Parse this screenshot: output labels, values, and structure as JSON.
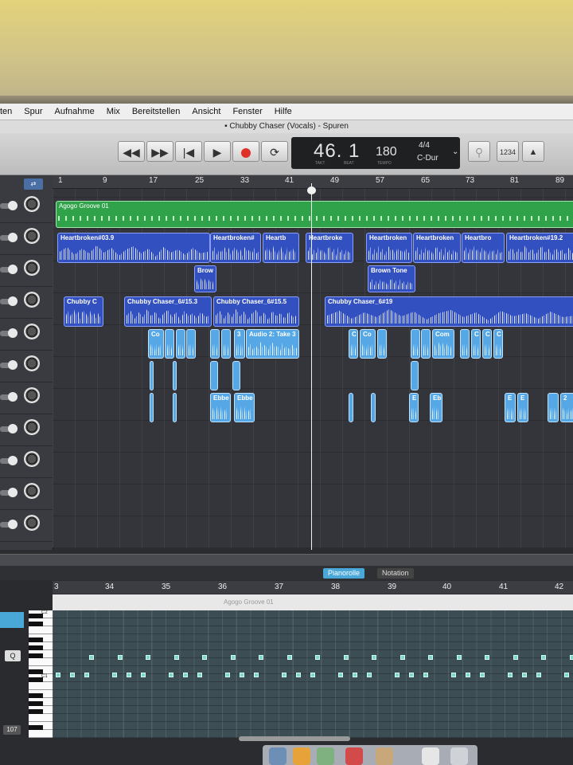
{
  "menu": {
    "items": [
      "ten",
      "Spur",
      "Aufnahme",
      "Mix",
      "Bereitstellen",
      "Ansicht",
      "Fenster",
      "Hilfe"
    ]
  },
  "window": {
    "title": "Chubby Chaser (Vocals) - Spuren"
  },
  "transport": {
    "rewind": "◀◀",
    "forward": "▶▶",
    "tostart": "|◀",
    "play": "▶",
    "cycle": "⟳",
    "tuner": "⚲",
    "count_in": "1234",
    "metronome": "▲"
  },
  "lcd": {
    "position": "46. 1",
    "tempo": "180",
    "signature": "4/4",
    "key": "C-Dur",
    "takt": "TAKT",
    "beat": "BEAT",
    "tempo_label": "TEMPO"
  },
  "ruler": {
    "bars": [
      "1",
      "9",
      "17",
      "25",
      "33",
      "41",
      "49",
      "57",
      "65",
      "73",
      "81",
      "89"
    ]
  },
  "regions": {
    "agogo": "Agogo Groove 01",
    "hb1": "Heartbroken#03.9",
    "hb2": "Heartbroken#",
    "hb3": "Heartb",
    "hb4": "Heartbroke",
    "hb5": "Heartbroken",
    "hb6": "Heartbroken",
    "hb7": "Heartbro",
    "hb8": "Heartbroken#19.2",
    "brow": "Brow",
    "brown": "Brown Tone",
    "cc1": "Chubby C",
    "cc2": "Chubby Chaser_6#15.3",
    "cc3": "Chubby Chaser_6#15.5",
    "cc4": "Chubby Chaser_6#19",
    "co1": "Co",
    "a3": "3",
    "audio2": "Audio 2: Take 3",
    "c1": "C",
    "co2": "Co",
    "com": "Com",
    "c2": "C",
    "c3": "C",
    "c4": "C",
    "ebbe1": "Ebbe",
    "ebbe2": "Ebbe",
    "e1": "E",
    "eb": "Eb",
    "e2": "E",
    "e3": "E",
    "n2": "2"
  },
  "editor": {
    "tab_piano": "Pianorolle",
    "tab_notation": "Notation",
    "region_name": "Agogo Groove 01",
    "bars": [
      "3",
      "34",
      "35",
      "36",
      "37",
      "38",
      "39",
      "40",
      "41",
      "42"
    ],
    "key_c2": "C2",
    "key_c1": "C1",
    "q_label": "Q",
    "num": "107"
  },
  "colors": {
    "audio": "#3250c0",
    "midi": "#2fa24a",
    "accent": "#4aa8d8",
    "record": "#e0302a"
  }
}
